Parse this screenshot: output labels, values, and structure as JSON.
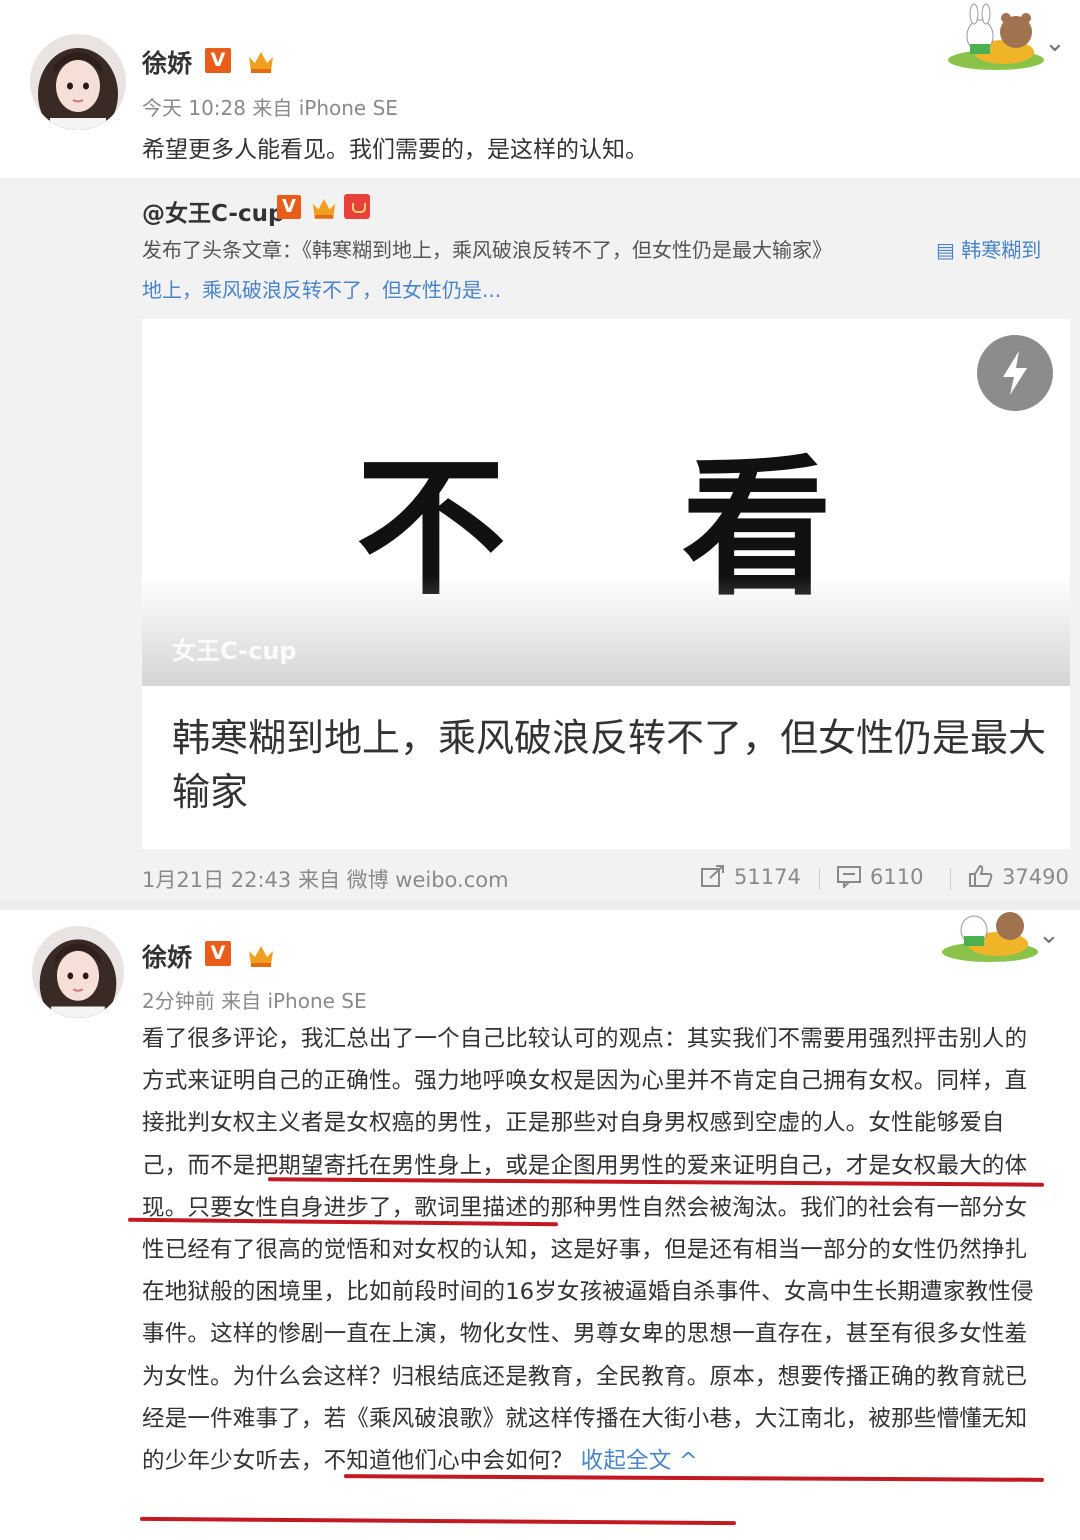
{
  "post1": {
    "user": "徐娇",
    "verified": "V",
    "meta": "今天 10:28 来自 iPhone SE",
    "text": "希望更多人能看见。我们需要的，是这样的认知。",
    "repost": {
      "user": "@女王C-cup",
      "verified": "V",
      "line1": "发布了头条文章：《韩寒糊到地上，乘风破浪反转不了，但女性仍是最大输家》",
      "link_a": "▤ 韩寒糊到",
      "link_b": "地上，乘风破浪反转不了，但女性仍是...",
      "card": {
        "image_text_left": "不",
        "image_text_right": "看",
        "watermark": "女王C-cup",
        "title": "韩寒糊到地上，乘风破浪反转不了，但女性仍是最大输家"
      },
      "meta": "1月21日 22:43 来自 微博 weibo.com",
      "shares": "51174",
      "comments": "6110",
      "likes": "37490"
    }
  },
  "post2": {
    "user": "徐娇",
    "verified": "V",
    "meta": "2分钟前 来自 iPhone SE",
    "body": "看了很多评论，我汇总出了一个自己比较认可的观点：其实我们不需要用强烈抨击别人的方式来证明自己的正确性。强力地呼唤女权是因为心里并不肯定自己拥有女权。同样，直接批判女权主义者是女权癌的男性，正是那些对自身男权感到空虚的人。女性能够爱自己，而不是把期望寄托在男性身上，或是企图用男性的爱来证明自己，才是女权最大的体现。只要女性自身进步了，歌词里描述的那种男性自然会被淘汰。我们的社会有一部分女性已经有了很高的觉悟和对女权的认知，这是好事，但是还有相当一部分的女性仍然挣扎在地狱般的困境里，比如前段时间的16岁女孩被逼婚自杀事件、女高中生长期遭家教性侵事件。这样的惨剧一直在上演，物化女性、男尊女卑的思想一直存在，甚至有很多女性羞为女性。为什么会这样？归根结底还是教育，全民教育。原本，想要传播正确的教育就已经是一件难事了，若《乘风破浪歌》就这样传播在大街小巷，大江南北，被那些懵懂无知的少年少女听去，不知道他们心中会如何？",
    "expand_label": "收起全文 ^"
  },
  "colors": {
    "link": "#4a84c8",
    "badge": "#e85d1a",
    "underline": "#c11a22"
  }
}
